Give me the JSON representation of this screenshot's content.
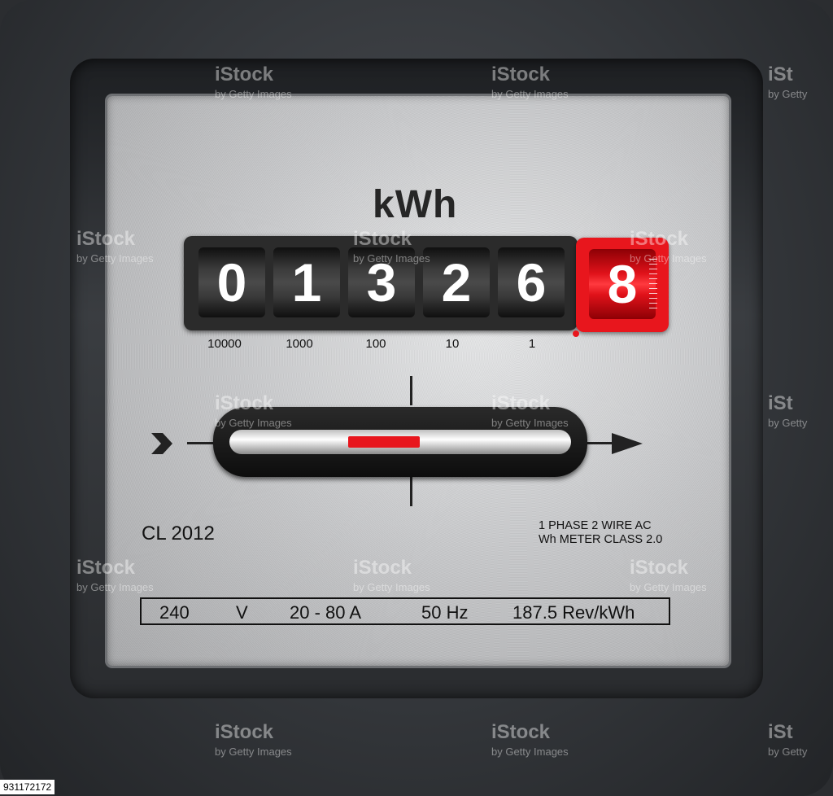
{
  "meter": {
    "unit": "kWh",
    "digits": [
      "0",
      "1",
      "3",
      "2",
      "6"
    ],
    "red_digit": "8",
    "multipliers": [
      "10000",
      "1000",
      "100",
      "10",
      "1"
    ],
    "class_mark": "CL 2012",
    "phase_line1": "1 PHASE 2 WIRE AC",
    "phase_line2": "Wh METER CLASS 2.0",
    "spec": {
      "voltage": "240",
      "voltage_unit": "V",
      "current": "20 - 80 A",
      "frequency": "50 Hz",
      "constant": "187.5 Rev/kWh"
    },
    "colors": {
      "red": "#e8161d",
      "digit_bg": "#2b2b2b"
    }
  },
  "watermark": {
    "brand": "iStock",
    "byline": "by Getty Images",
    "short_byline": "by Getty",
    "short_brand": "iSt"
  },
  "image_id": "931172172"
}
